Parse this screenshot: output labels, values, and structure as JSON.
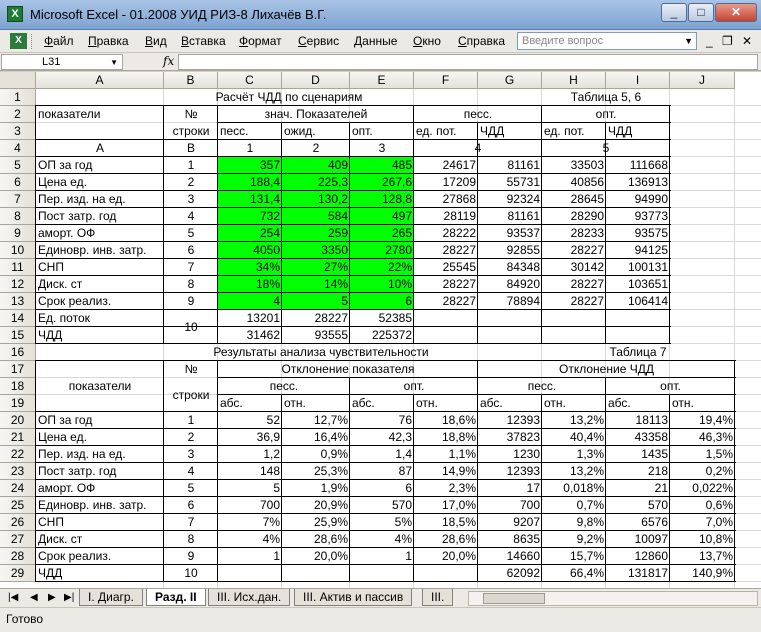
{
  "app": {
    "title": "Microsoft Excel - 01.2008 УИД РИЗ-8 Лихачёв В.Г.",
    "icon": "excel-icon"
  },
  "menu": [
    "Файл",
    "Правка",
    "Вид",
    "Вставка",
    "Формат",
    "Сервис",
    "Данные",
    "Окно",
    "Справка"
  ],
  "help_placeholder": "Введите вопрос",
  "formula_bar": {
    "name_box": "L31",
    "fx": "fx",
    "content": ""
  },
  "columns": [
    "A",
    "B",
    "C",
    "D",
    "E",
    "F",
    "G",
    "H",
    "I",
    "J"
  ],
  "rows": [
    "1",
    "2",
    "3",
    "4",
    "5",
    "6",
    "7",
    "8",
    "9",
    "10",
    "11",
    "12",
    "13",
    "14",
    "15",
    "16",
    "17",
    "18",
    "19",
    "20",
    "21",
    "22",
    "23",
    "24",
    "25",
    "26",
    "27",
    "28",
    "29"
  ],
  "table5": {
    "title": "Расчёт ЧДД по сценариям",
    "table_no": "Таблица 5, 6",
    "h_indicators": "показатели",
    "h_no": "№",
    "h_rows": "строки",
    "h_values": "знач. Показателей",
    "h_pess": "песс.",
    "h_exp": "ожид.",
    "h_opt": "опт.",
    "h_pess2": "песс.",
    "h_opt2": "опт.",
    "h_unit_pot": "ед. пот.",
    "h_chdd": "ЧДД",
    "h_unit_pot2": "ед. пот.",
    "h_chdd2": "ЧДД",
    "idx": [
      "А",
      "В",
      "1",
      "2",
      "3",
      "4",
      "5"
    ],
    "rows": [
      {
        "name": "ОП за год",
        "n": "1",
        "c": "357",
        "d": "409",
        "e": "485",
        "f": "24617",
        "g": "81161",
        "h": "33503",
        "i": "111668"
      },
      {
        "name": "Цена ед.",
        "n": "2",
        "c": "188,4",
        "d": "225,3",
        "e": "267,6",
        "f": "17209",
        "g": "55731",
        "h": "40856",
        "i": "136913"
      },
      {
        "name": "Пер. изд. на ед.",
        "n": "3",
        "c": "131,4",
        "d": "130,2",
        "e": "128,8",
        "f": "27868",
        "g": "92324",
        "h": "28645",
        "i": "94990"
      },
      {
        "name": "Пост затр. год",
        "n": "4",
        "c": "732",
        "d": "584",
        "e": "497",
        "f": "28119",
        "g": "81161",
        "h": "28290",
        "i": "93773"
      },
      {
        "name": "аморт. ОФ",
        "n": "5",
        "c": "254",
        "d": "259",
        "e": "265",
        "f": "28222",
        "g": "93537",
        "h": "28233",
        "i": "93575"
      },
      {
        "name": "Единовр. инв. затр.",
        "n": "6",
        "c": "4050",
        "d": "3350",
        "e": "2780",
        "f": "28227",
        "g": "92855",
        "h": "28227",
        "i": "94125"
      },
      {
        "name": "СНП",
        "n": "7",
        "c": "34%",
        "d": "27%",
        "e": "22%",
        "f": "25545",
        "g": "84348",
        "h": "30142",
        "i": "100131"
      },
      {
        "name": "Диск. ст",
        "n": "8",
        "c": "18%",
        "d": "14%",
        "e": "10%",
        "f": "28227",
        "g": "84920",
        "h": "28227",
        "i": "103651"
      },
      {
        "name": "Срок реализ.",
        "n": "9",
        "c": "4",
        "d": "5",
        "e": "6",
        "f": "28227",
        "g": "78894",
        "h": "28227",
        "i": "106414"
      }
    ],
    "flow": {
      "name": "Ед. поток",
      "c": "13201",
      "d": "28227",
      "e": "52385"
    },
    "chdd": {
      "name": "ЧДД",
      "n": "10",
      "c": "31462",
      "d": "93555",
      "e": "225372"
    }
  },
  "table7": {
    "title": "Результаты анализа чувствительности",
    "table_no": "Таблица 7",
    "h_indicators": "показатели",
    "h_no": "№",
    "h_rows": "строки",
    "h_dev_ind": "Отклонение показателя",
    "h_dev_chdd": "Отклонение ЧДД",
    "h_pess": "песс.",
    "h_opt": "опт.",
    "h_pess2": "песс.",
    "h_opt2": "опт.",
    "h_abs": "абс.",
    "h_rel": "отн.",
    "rows": [
      {
        "name": "ОП за год",
        "n": "1",
        "c": "52",
        "d": "12,7%",
        "e": "76",
        "f": "18,6%",
        "g": "12393",
        "h": "13,2%",
        "i": "18113",
        "j": "19,4%"
      },
      {
        "name": "Цена ед.",
        "n": "2",
        "c": "36,9",
        "d": "16,4%",
        "e": "42,3",
        "f": "18,8%",
        "g": "37823",
        "h": "40,4%",
        "i": "43358",
        "j": "46,3%"
      },
      {
        "name": "Пер. изд. на ед.",
        "n": "3",
        "c": "1,2",
        "d": "0,9%",
        "e": "1,4",
        "f": "1,1%",
        "g": "1230",
        "h": "1,3%",
        "i": "1435",
        "j": "1,5%"
      },
      {
        "name": "Пост затр. год",
        "n": "4",
        "c": "148",
        "d": "25,3%",
        "e": "87",
        "f": "14,9%",
        "g": "12393",
        "h": "13,2%",
        "i": "218",
        "j": "0,2%"
      },
      {
        "name": "аморт. ОФ",
        "n": "5",
        "c": "5",
        "d": "1,9%",
        "e": "6",
        "f": "2,3%",
        "g": "17",
        "h": "0,018%",
        "i": "21",
        "j": "0,022%"
      },
      {
        "name": "Единовр. инв. затр.",
        "n": "6",
        "c": "700",
        "d": "20,9%",
        "e": "570",
        "f": "17,0%",
        "g": "700",
        "h": "0,7%",
        "i": "570",
        "j": "0,6%"
      },
      {
        "name": "СНП",
        "n": "7",
        "c": "7%",
        "d": "25,9%",
        "e": "5%",
        "f": "18,5%",
        "g": "9207",
        "h": "9,8%",
        "i": "6576",
        "j": "7,0%"
      },
      {
        "name": "Диск. ст",
        "n": "8",
        "c": "4%",
        "d": "28,6%",
        "e": "4%",
        "f": "28,6%",
        "g": "8635",
        "h": "9,2%",
        "i": "10097",
        "j": "10,8%"
      },
      {
        "name": "Срок реализ.",
        "n": "9",
        "c": "1",
        "d": "20,0%",
        "e": "1",
        "f": "20,0%",
        "g": "14660",
        "h": "15,7%",
        "i": "12860",
        "j": "13,7%"
      },
      {
        "name": "ЧДД",
        "n": "10",
        "c": "",
        "d": "",
        "e": "",
        "f": "",
        "g": "62092",
        "h": "66,4%",
        "i": "131817",
        "j": "140,9%"
      }
    ]
  },
  "sheet_tabs": [
    "I. Диагр.",
    "Разд. II",
    "III. Исх.дан.",
    "III. Актив и пассив",
    "III."
  ],
  "active_tab": "Разд. II",
  "status": "Готово",
  "colors": {
    "highlight": "#00ff00",
    "excel_green": "#1e7b34"
  }
}
